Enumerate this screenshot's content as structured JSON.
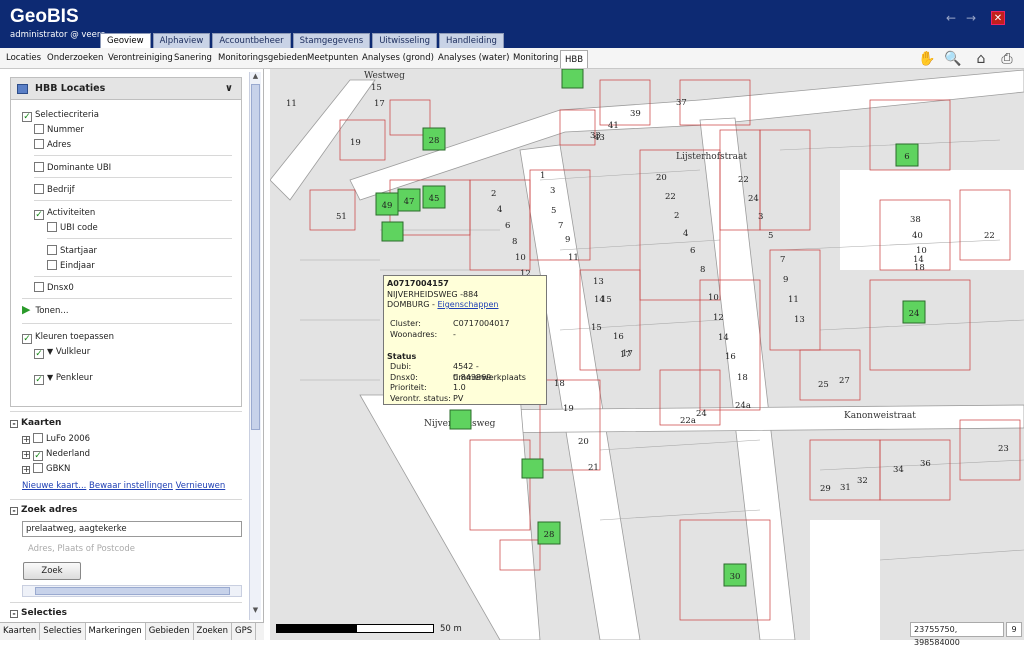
{
  "header": {
    "title": "GeoBIS",
    "user": "administrator @ veere",
    "tabs": [
      "Geoview",
      "Alphaview",
      "Accountbeheer",
      "Stamgegevens",
      "Uitwisseling",
      "Handleiding"
    ],
    "active_tab": "Geoview"
  },
  "subnav": {
    "items": [
      "Locaties",
      "Onderzoeken",
      "Verontreiniging",
      "Sanering",
      "Monitoringsgebieden",
      "Meetpunten",
      "Analyses (grond)",
      "Analyses (water)",
      "Monitoring",
      "HBB"
    ],
    "active": "HBB"
  },
  "hbb": {
    "title": "HBB Locaties",
    "selectie": "Selectiecriteria",
    "nummer": "Nummer",
    "adres": "Adres",
    "dominante_ubi": "Dominante UBI",
    "bedrijf": "Bedrijf",
    "activiteiten": "Activiteiten",
    "ubi_code": "UBI code",
    "startjaar": "Startjaar",
    "eindjaar": "Eindjaar",
    "dnsx0": "Dnsx0",
    "tonen": "Tonen...",
    "kleuren": "Kleuren toepassen",
    "vulkleur": "Vulkleur",
    "penkleur": "Penkleur"
  },
  "kaarten": {
    "title": "Kaarten",
    "items": [
      "LuFo 2006",
      "Nederland",
      "GBKN"
    ],
    "links": [
      "Nieuwe kaart...",
      "Bewaar instellingen",
      "Vernieuwen"
    ]
  },
  "zoek_adres": {
    "title": "Zoek adres",
    "value": "prelaatweg, aagtekerke",
    "placeholder": "Adres, Plaats of Postcode",
    "button": "Zoek"
  },
  "selecties": {
    "title": "Selecties"
  },
  "bottom_tabs": [
    "Kaarten",
    "Selecties",
    "Markeringen",
    "Gebieden",
    "Zoeken",
    "GPS"
  ],
  "map": {
    "roads": [
      "Westweg",
      "Lijsterhofstraat",
      "Nijverheidsweg",
      "Kanonweistraat"
    ],
    "markers": [
      "28",
      "49",
      "47",
      "45",
      "6",
      "24",
      "28",
      "30"
    ],
    "house_numbers": [
      "11",
      "15",
      "17",
      "19",
      "33",
      "37",
      "39",
      "41",
      "43",
      "51",
      "1",
      "2",
      "3",
      "4",
      "5",
      "6",
      "7",
      "8",
      "9",
      "10",
      "11",
      "12",
      "13",
      "14",
      "15",
      "16",
      "17",
      "18",
      "19",
      "20",
      "21",
      "22",
      "22a",
      "23",
      "24",
      "24a",
      "25",
      "27",
      "29",
      "31",
      "32",
      "34",
      "36",
      "38",
      "40",
      "10",
      "14",
      "18",
      "20",
      "22",
      "2",
      "4",
      "6",
      "8",
      "10",
      "12",
      "14",
      "16",
      "18",
      "20",
      "22",
      "24",
      "3",
      "5",
      "7",
      "9",
      "11",
      "13",
      "15",
      "17",
      "19",
      "21"
    ],
    "scale_label": "50 m",
    "coordinates": "23755750, 398584000",
    "zoom": "9"
  },
  "popup": {
    "id": "A0717004157",
    "address": "NIJVERHEIDSWEG -884",
    "city": "DOMBURG - ",
    "link": "Eigenschappen",
    "cluster_label": "Cluster:",
    "cluster": "C0717004017",
    "woonadres_label": "Woonadres:",
    "woonadres": "-",
    "status_title": "Status",
    "dubi_label": "Dubi:",
    "dubi": "4542 - timmerwerkplaats",
    "dnsx0_label": "Dnsx0:",
    "dnsx0": "0.843869",
    "prioriteit_label": "Prioriteit:",
    "prioriteit": "1.0",
    "verontr_label": "Verontr. status:",
    "verontr": "PV"
  }
}
